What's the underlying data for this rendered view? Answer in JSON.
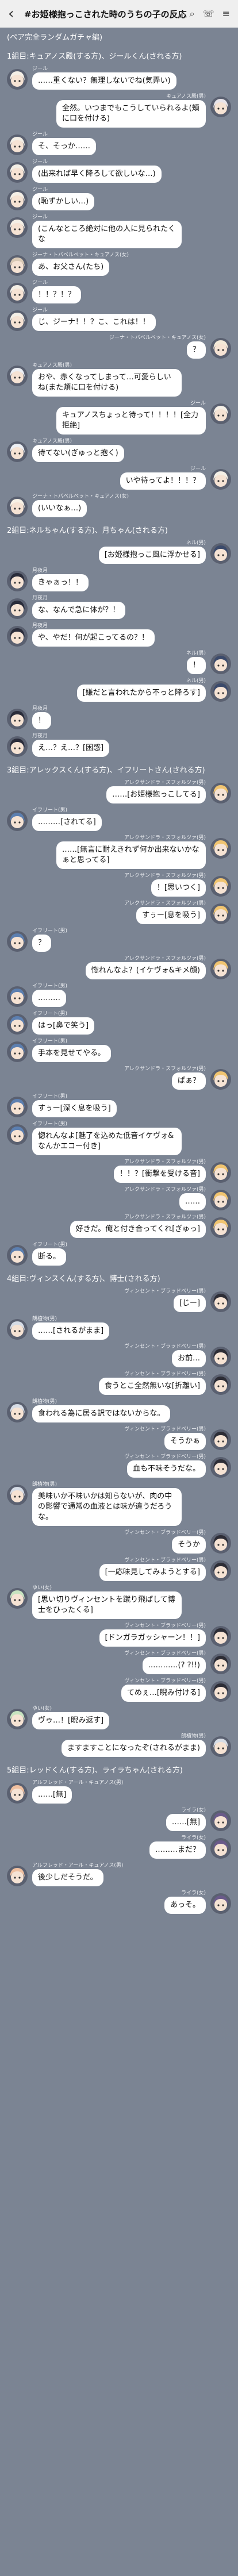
{
  "header": {
    "title": "#お姫様抱っこされた時のうちの子の反応",
    "back_icon": "chevron-left-icon",
    "icons": [
      "search-icon",
      "phone-icon",
      "menu-icon"
    ]
  },
  "intro": "(ペア完全ランダムガチャ編)",
  "sections": [
    {
      "title": "1組目:キュアノス殿(する方)、ジールくん(される方)",
      "messages": [
        {
          "side": "l",
          "avatar": "jeel",
          "name": "ジール",
          "text": "……重くない？無理しないでね(気弄い)"
        },
        {
          "side": "r",
          "avatar": "kyanos",
          "name": "キュアノス殿(男)",
          "text": "全然。いつまでもこうしていられるよ(頬に口を付ける)"
        },
        {
          "side": "l",
          "avatar": "jeel",
          "name": "ジール",
          "text": "そ、そっか……"
        },
        {
          "side": "l",
          "avatar": "jeel",
          "name": "ジール",
          "text": "(出来れば早く降ろして欲しいな…)"
        },
        {
          "side": "l",
          "avatar": "jeel",
          "name": "ジール",
          "text": "(恥ずかしい…)"
        },
        {
          "side": "l",
          "avatar": "jeel",
          "name": "ジール",
          "text": "(こんなところ絶対に他の人に見られたくな"
        },
        {
          "side": "l",
          "avatar": "jeel2",
          "name": "ジーナ・トバベルベット・キュアノス(女)",
          "text": "あ、お父さん(たち)"
        },
        {
          "side": "l",
          "avatar": "jeel",
          "name": "ジール",
          "text": "！！？！？"
        },
        {
          "side": "l",
          "avatar": "jeel",
          "name": "ジール",
          "text": "じ、ジーナ！！？こ、これは！！"
        },
        {
          "side": "r",
          "avatar": "jeena",
          "name": "ジーナ・トバベルベット・キュアノス(女)",
          "text": "？"
        },
        {
          "side": "l",
          "avatar": "kyanos2",
          "name": "キュアノス殿(男)",
          "text": "おや、赤くなってしまって…可愛らしいね(また頬に口を付ける)"
        },
        {
          "side": "r",
          "avatar": "jeel3",
          "name": "ジール",
          "text": "キュアノスちょっと待って！！！！[全力拒絶]"
        },
        {
          "side": "l",
          "avatar": "kyanos2",
          "name": "キュアノス殿(男)",
          "text": "待てない(ぎゅっと抱く)"
        },
        {
          "side": "r",
          "avatar": "jeel3",
          "name": "ジール",
          "text": "いや待ってよ！！！？"
        },
        {
          "side": "l",
          "avatar": "jeena2",
          "name": "ジーナ・トバベルベット・キュアノス(女)",
          "text": "(いいなぁ…)"
        }
      ]
    },
    {
      "title": "2組目:ネルちゃん(する方)、月ちゃん(される方)",
      "messages": [
        {
          "side": "r",
          "avatar": "neru",
          "name": "ネル(男)",
          "text": "[お姫様抱っこ風に浮かせる]"
        },
        {
          "side": "l",
          "avatar": "tsuki",
          "name": "月夜月",
          "text": "きゃぁっ！！"
        },
        {
          "side": "l",
          "avatar": "tsuki",
          "name": "月夜月",
          "text": "な、なんで急に体が？！"
        },
        {
          "side": "l",
          "avatar": "tsuki",
          "name": "月夜月",
          "text": "や、やだ！何が起こってるの？！"
        },
        {
          "side": "r",
          "avatar": "neru",
          "name": "ネル(男)",
          "text": "！"
        },
        {
          "side": "r",
          "avatar": "neru",
          "name": "ネル(男)",
          "text": "[嫌だと言われたから不っと降ろす]"
        },
        {
          "side": "l",
          "avatar": "tsuki",
          "name": "月夜月",
          "text": "！"
        },
        {
          "side": "l",
          "avatar": "tsuki",
          "name": "月夜月",
          "text": "え…？え…？[困惑]"
        }
      ]
    },
    {
      "title": "3組目:アレックスくん(する方)、イフリートさん(される方)",
      "messages": [
        {
          "side": "r",
          "avatar": "alex",
          "name": "アレクサンドラ・スフォルツァ(男)",
          "text": "……[お姫様抱っこしてる]"
        },
        {
          "side": "l",
          "avatar": "ifrit",
          "name": "イフリート(男)",
          "text": "………[されてる]"
        },
        {
          "side": "r",
          "avatar": "alex",
          "name": "アレクサンドラ・スフォルツァ(男)",
          "text": "……[無言に耐えきれず何か出来ないかなぁと思ってる]"
        },
        {
          "side": "r",
          "avatar": "alex",
          "name": "アレクサンドラ・スフォルツァ(男)",
          "text": "！[思いつく]"
        },
        {
          "side": "r",
          "avatar": "alex",
          "name": "アレクサンドラ・スフォルツァ(男)",
          "text": "すぅー[息を吸う]"
        },
        {
          "side": "l",
          "avatar": "ifrit",
          "name": "イフリート(男)",
          "text": "？"
        },
        {
          "side": "r",
          "avatar": "alex",
          "name": "アレクサンドラ・スフォルツァ(男)",
          "text": "惚れんなよ？(イケヴォ&キメ顔)"
        },
        {
          "side": "l",
          "avatar": "ifrit",
          "name": "イフリート(男)",
          "text": "………"
        },
        {
          "side": "l",
          "avatar": "ifrit",
          "name": "イフリート(男)",
          "text": "はっ[鼻で笑う]"
        },
        {
          "side": "l",
          "avatar": "ifrit",
          "name": "イフリート(男)",
          "text": "手本を見せてやる。"
        },
        {
          "side": "r",
          "avatar": "alex",
          "name": "アレクサンドラ・スフォルツァ(男)",
          "text": "ぱぁ？"
        },
        {
          "side": "l",
          "avatar": "ifrit",
          "name": "イフリート(男)",
          "text": "すぅー[深く息を吸う]"
        },
        {
          "side": "l",
          "avatar": "ifrit",
          "name": "イフリート(男)",
          "text": "惚れんなよ[魅了を込めた低音イケヴォ&なんかエコー付き]"
        },
        {
          "side": "r",
          "avatar": "alex",
          "name": "アレクサンドラ・スフォルツァ(男)",
          "text": "！！？[衝撃を受ける音]"
        },
        {
          "side": "r",
          "avatar": "alex",
          "name": "アレクサンドラ・スフォルツァ(男)",
          "text": "……"
        },
        {
          "side": "r",
          "avatar": "alex",
          "name": "アレクサンドラ・スフォルツァ(男)",
          "text": "好きだ。俺と付き合ってくれ[ぎゅっ]"
        },
        {
          "side": "l",
          "avatar": "ifrit",
          "name": "イフリート(男)",
          "text": "断る。"
        }
      ]
    },
    {
      "title": "4組目:ヴィンスくん(する方)、博士(される方)",
      "messages": [
        {
          "side": "r",
          "avatar": "vince",
          "name": "ヴィンセント・ブラッドベリー(男)",
          "text": "[じー]"
        },
        {
          "side": "l",
          "avatar": "doctor",
          "name": "朗植物(男)",
          "text": "……[されるがまま]"
        },
        {
          "side": "r",
          "avatar": "vince",
          "name": "ヴィンセント・ブラッドベリー(男)",
          "text": "お前…"
        },
        {
          "side": "r",
          "avatar": "vince",
          "name": "ヴィンセント・ブラッドベリー(男)",
          "text": "食うとこ全然無いな[折離い]"
        },
        {
          "side": "l",
          "avatar": "doctor",
          "name": "朗植物(男)",
          "text": "食われる為に居る訳ではないからな。"
        },
        {
          "side": "r",
          "avatar": "vince",
          "name": "ヴィンセント・ブラッドベリー(男)",
          "text": "そうかぁ"
        },
        {
          "side": "r",
          "avatar": "vince",
          "name": "ヴィンセント・ブラッドベリー(男)",
          "text": "血も不味そうだな。"
        },
        {
          "side": "l",
          "avatar": "doctor",
          "name": "朗植物(男)",
          "text": "美味いか不味いかは知らないが、肉の中の影響で通常の血液とは味が違うだろうな。"
        },
        {
          "side": "r",
          "avatar": "vince",
          "name": "ヴィンセント・ブラッドベリー(男)",
          "text": "そうか"
        },
        {
          "side": "r",
          "avatar": "vince",
          "name": "ヴィンセント・ブラッドベリー(男)",
          "text": "[一応味見してみようとする]"
        },
        {
          "side": "l",
          "avatar": "yui",
          "name": "ゆい(女)",
          "text": "[思い切りヴィンセントを蹴り飛ばして博士をひったくる]"
        },
        {
          "side": "r",
          "avatar": "vince",
          "name": "ヴィンセント・ブラッドベリー(男)",
          "text": "[ドンガラガッシャーン！！]"
        },
        {
          "side": "r",
          "avatar": "vince",
          "name": "ヴィンセント・ブラッドベリー(男)",
          "text": "…………(? ?!!)"
        },
        {
          "side": "r",
          "avatar": "vince",
          "name": "ヴィンセント・ブラッドベリー(男)",
          "text": "てめぇ…[睨み付ける]"
        },
        {
          "side": "l",
          "avatar": "yui",
          "name": "ゆい(女)",
          "text": "ヴゥ…！[睨み返す]"
        },
        {
          "side": "r",
          "avatar": "doctor2",
          "name": "朗植物(男)",
          "text": "ますますことになったぞ(されるがまま)"
        }
      ]
    },
    {
      "title": "5組目:レッドくん(する方)、ライラちゃん(される方)",
      "messages": [
        {
          "side": "l",
          "avatar": "red",
          "name": "アルフレッド・アール・キュアノス(男)",
          "text": "……[無]"
        },
        {
          "side": "r",
          "avatar": "laila",
          "name": "ライラ(女)",
          "text": "……[無]"
        },
        {
          "side": "r",
          "avatar": "laila",
          "name": "ライラ(女)",
          "text": "………まだ？"
        },
        {
          "side": "l",
          "avatar": "red",
          "name": "アルフレッド・アール・キュアノス(男)",
          "text": "後少しだそうだ。"
        },
        {
          "side": "r",
          "avatar": "laila",
          "name": "ライラ(女)",
          "text": "あっそ。"
        }
      ]
    }
  ],
  "avatar_colors": {
    "jeel": "#f4efe6",
    "jeel2": "#d9c9b5",
    "jeel3": "#f4efe6",
    "kyanos": "#e8e4ea",
    "kyanos2": "#eceff4",
    "jeena": "#f3e9d8",
    "jeena2": "#f7f1e6",
    "neru": "#3b4a6b",
    "tsuki": "#2a2c3a",
    "alex": "#f0c470",
    "ifrit": "#5c7fb0",
    "vince": "#2d2d36",
    "doctor": "#d6dce6",
    "doctor2": "#d6dce6",
    "yui": "#c7e3c0",
    "red": "#f0c0a0",
    "laila": "#6a5a8a"
  }
}
